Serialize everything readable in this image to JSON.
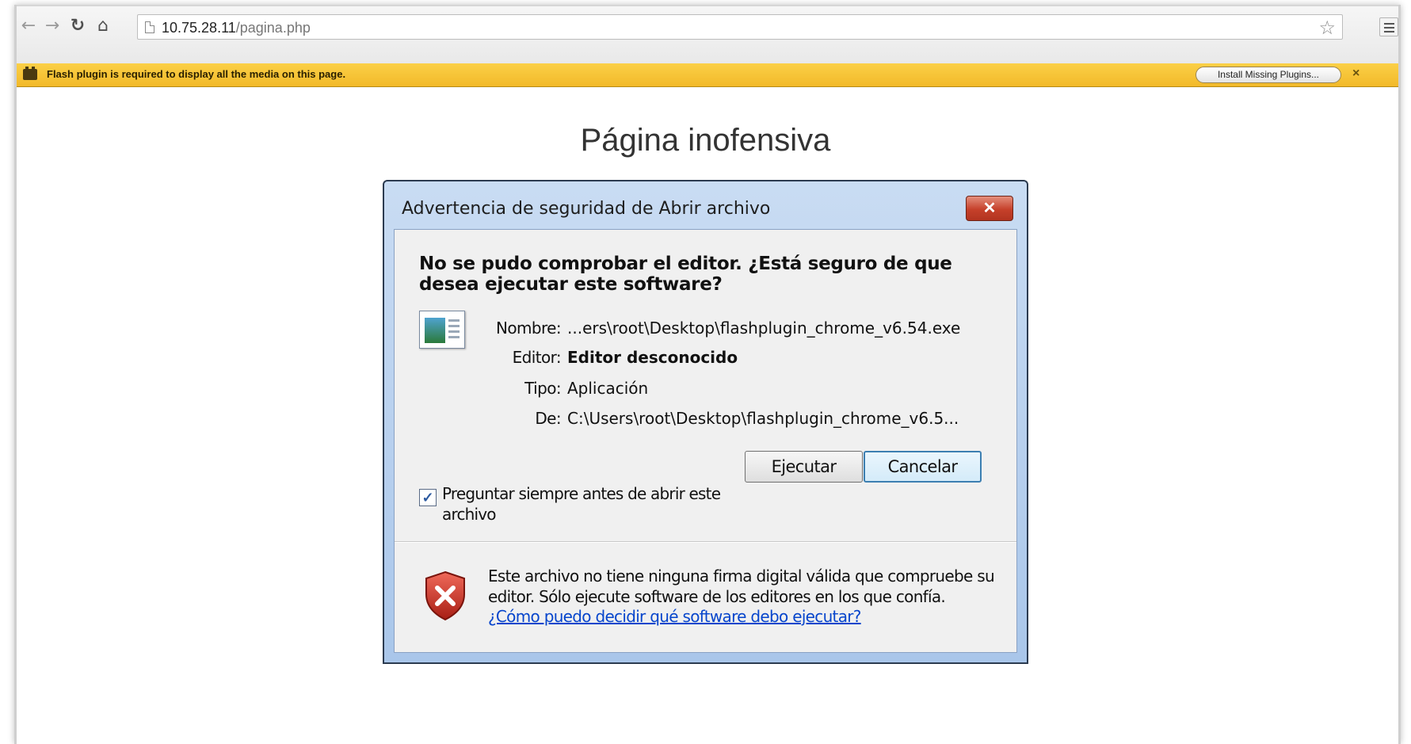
{
  "browser": {
    "url_host": "10.75.28.11",
    "url_path": "/pagina.php",
    "nav_icons": [
      "back-arrow-icon",
      "forward-arrow-icon",
      "reload-icon",
      "home-icon"
    ]
  },
  "infobar": {
    "message": "Flash plugin is required to display all the media on this page.",
    "install_label": "Install Missing Plugins...",
    "close_glyph": "×",
    "accent": "#f7c232"
  },
  "page": {
    "title": "Página inofensiva"
  },
  "dialog": {
    "title": "Advertencia de seguridad de Abrir archivo",
    "close_glyph": "✕",
    "question": "No se pudo comprobar el editor. ¿Está seguro de que desea ejecutar este software?",
    "fields": [
      {
        "label": "Nombre:",
        "value": "...ers\\root\\Desktop\\flashplugin_chrome_v6.54.exe"
      },
      {
        "label": "Editor:",
        "value": "Editor desconocido"
      },
      {
        "label": "Tipo:",
        "value": "Aplicación"
      },
      {
        "label": "De:",
        "value": "C:\\Users\\root\\Desktop\\flashplugin_chrome_v6.5..."
      }
    ],
    "run_label": "Ejecutar",
    "cancel_label": "Cancelar",
    "checkbox_label": "Preguntar siempre antes de abrir este archivo",
    "checkbox_checked": true,
    "warning": "Este archivo no tiene ninguna firma digital válida que compruebe su editor. Sólo ejecute software de los editores en los que confía.",
    "help_link": "¿Cómo puedo decidir qué software debo ejecutar?",
    "close_color": "#c5402a"
  }
}
